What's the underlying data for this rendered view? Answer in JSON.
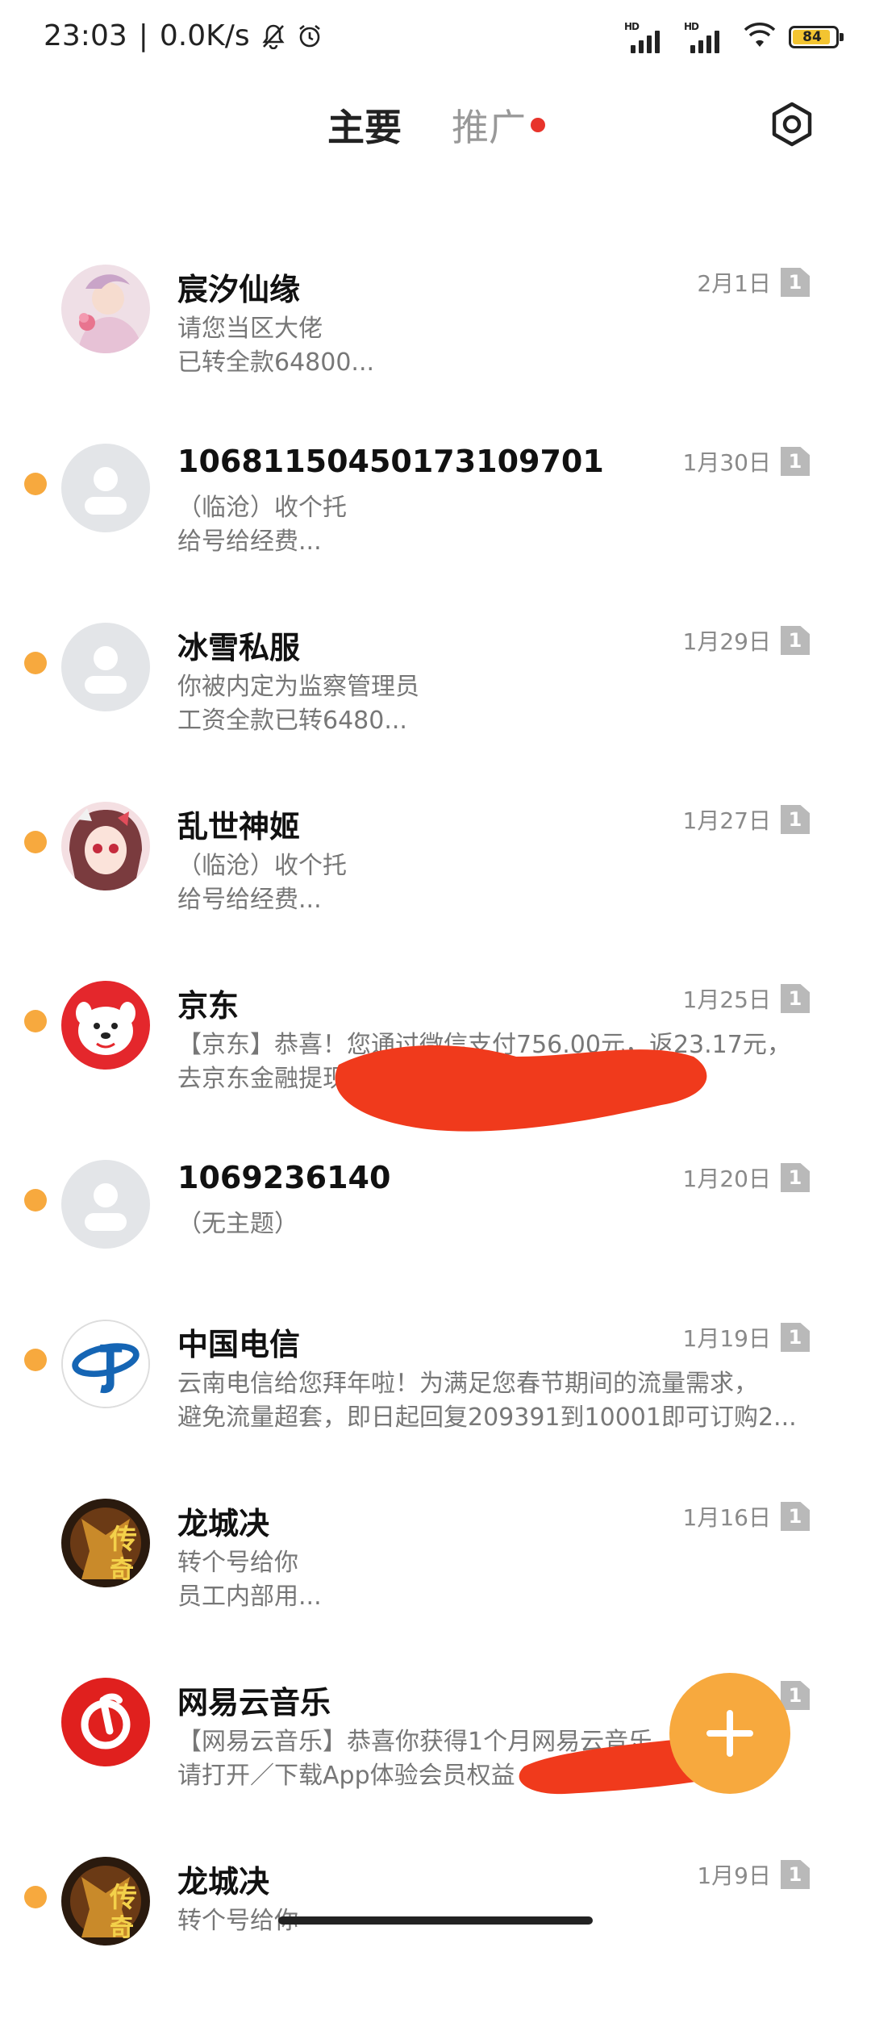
{
  "status_bar": {
    "time": "23:03",
    "speed": "0.0K/s",
    "battery": "84",
    "hd1": "HD",
    "hd2": "HD"
  },
  "header": {
    "tab_main": "主要",
    "tab_promo": "推广"
  },
  "messages": [
    {
      "name": "宸汐仙缘",
      "date": "2月1日",
      "sim": "1",
      "line1": "请您当区大佬",
      "line2": "已转全款64800..."
    },
    {
      "name": "106811504501731097​01",
      "date": "1月30日",
      "sim": "1",
      "line1": "（临沧）收个托",
      "line2": "给号给经费..."
    },
    {
      "name": "冰雪私服",
      "date": "1月29日",
      "sim": "1",
      "line1": "你被内定为监察管理员",
      "line2": "工资全款已转6480..."
    },
    {
      "name": "乱世神姬",
      "date": "1月27日",
      "sim": "1",
      "line1": "（临沧）收个托",
      "line2": "给号给经费..."
    },
    {
      "name": "京东",
      "date": "1月25日",
      "sim": "1",
      "line1": "【京东】恭喜！您通过微信支付756.00元，返23.17元，",
      "line2": "去京东金融提现"
    },
    {
      "name": "1069236140",
      "date": "1月20日",
      "sim": "1",
      "line1": "（无主题）",
      "line2": ""
    },
    {
      "name": "中国电信",
      "date": "1月19日",
      "sim": "1",
      "line1": "云南电信给您拜年啦！为满足您春节期间的流量需求，",
      "line2": "避免流量超套，即日起回复209391到10001即可订购2..."
    },
    {
      "name": "龙城决",
      "date": "1月16日",
      "sim": "1",
      "line1": "转个号给你",
      "line2": "员工内部用..."
    },
    {
      "name": "网易云音乐",
      "date": "",
      "sim": "1",
      "line1": "【网易云音乐】恭喜你获得1个月网易云音乐",
      "line2": "请打开／下载App体验会员权益"
    },
    {
      "name": "龙城决",
      "date": "1月9日",
      "sim": "1",
      "line1": "转个号给你",
      "line2": ""
    }
  ],
  "avatar_icons": [
    "fairy-avatar",
    "default-person-icon",
    "default-person-icon",
    "anime-girl-avatar",
    "jd-dog-logo",
    "default-person-icon",
    "china-telecom-logo",
    "legend-game-avatar",
    "netease-music-logo",
    "legend-game-avatar"
  ],
  "colors": {
    "unread_dot": "#f7a93e",
    "promo_dot": "#e8342b",
    "fab": "#f7a93e",
    "redaction": "#f03a1c"
  }
}
